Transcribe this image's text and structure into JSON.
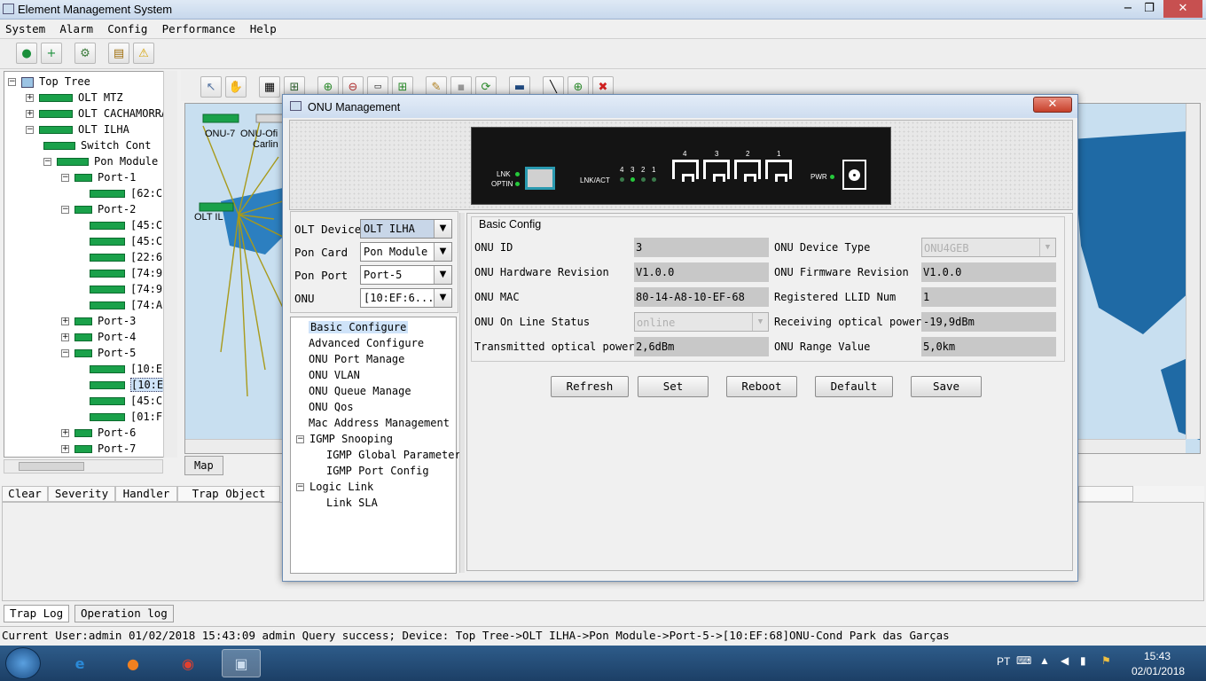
{
  "window": {
    "title": "Element Management System",
    "minimize": "−",
    "maximize": "❐",
    "close": "✕"
  },
  "menu": [
    "System",
    "Alarm",
    "Config",
    "Performance",
    "Help"
  ],
  "tree": {
    "items": [
      {
        "label": "Top Tree",
        "depth": 0,
        "exp": "−",
        "icon": "globe"
      },
      {
        "label": "OLT MTZ",
        "depth": 1,
        "exp": "+",
        "icon": "dev"
      },
      {
        "label": "OLT CACHAMORRA",
        "depth": 1,
        "exp": "+",
        "icon": "dev"
      },
      {
        "label": "OLT ILHA",
        "depth": 1,
        "exp": "−",
        "icon": "dev"
      },
      {
        "label": "Switch Cont",
        "depth": 2,
        "exp": "",
        "icon": "sw"
      },
      {
        "label": "Pon Module",
        "depth": 2,
        "exp": "−",
        "icon": "sw"
      },
      {
        "label": "Port-1",
        "depth": 3,
        "exp": "−",
        "icon": "port"
      },
      {
        "label": "[62:C",
        "depth": 4,
        "exp": "",
        "icon": "onu"
      },
      {
        "label": "Port-2",
        "depth": 3,
        "exp": "−",
        "icon": "port"
      },
      {
        "label": "[45:C",
        "depth": 4,
        "exp": "",
        "icon": "onu"
      },
      {
        "label": "[45:C",
        "depth": 4,
        "exp": "",
        "icon": "onu"
      },
      {
        "label": "[22:6",
        "depth": 4,
        "exp": "",
        "icon": "onu"
      },
      {
        "label": "[74:9",
        "depth": 4,
        "exp": "",
        "icon": "onu"
      },
      {
        "label": "[74:9",
        "depth": 4,
        "exp": "",
        "icon": "onu"
      },
      {
        "label": "[74:A",
        "depth": 4,
        "exp": "",
        "icon": "onu"
      },
      {
        "label": "Port-3",
        "depth": 3,
        "exp": "+",
        "icon": "port"
      },
      {
        "label": "Port-4",
        "depth": 3,
        "exp": "+",
        "icon": "port"
      },
      {
        "label": "Port-5",
        "depth": 3,
        "exp": "−",
        "icon": "port"
      },
      {
        "label": "[10:E",
        "depth": 4,
        "exp": "",
        "icon": "onu"
      },
      {
        "label": "[10:E",
        "depth": 4,
        "exp": "",
        "icon": "onu",
        "selected": true
      },
      {
        "label": "[45:C",
        "depth": 4,
        "exp": "",
        "icon": "onu"
      },
      {
        "label": "[01:F",
        "depth": 4,
        "exp": "",
        "icon": "onu"
      },
      {
        "label": "Port-6",
        "depth": 3,
        "exp": "+",
        "icon": "port"
      },
      {
        "label": "Port-7",
        "depth": 3,
        "exp": "+",
        "icon": "port"
      }
    ]
  },
  "map": {
    "labels": [
      "ONU-7",
      "ONU-Ofi",
      "Carlin",
      "OLT IL"
    ],
    "tab": "Map"
  },
  "traplog": {
    "columns": [
      "Clear",
      "Severity",
      "Handler",
      "Trap Object"
    ],
    "tabs": [
      "Trap Log",
      "Operation log"
    ]
  },
  "status": {
    "text": "Current User:admin   01/02/2018 15:43:09  admin  Query  success; Device: Top Tree->OLT ILHA->Pon Module->Port-5->[10:EF:68]ONU-Cond Park das Garças"
  },
  "taskbar": {
    "lang": "PT",
    "time": "15:43",
    "date": "02/01/2018",
    "apps": [
      "IE",
      "FF",
      "Chrome",
      "EMS"
    ]
  },
  "dialog": {
    "title": "ONU Management",
    "close": "✕",
    "device": {
      "lnk": "LNK",
      "optin": "OPTIN",
      "lnkact": "LNK/ACT",
      "ports_small": [
        "4",
        "3",
        "2",
        "1"
      ],
      "ports": [
        "4",
        "3",
        "2",
        "1"
      ],
      "pwr": "PWR"
    },
    "form": [
      {
        "label": "OLT Device",
        "value": "OLT ILHA"
      },
      {
        "label": "Pon Card",
        "value": "Pon Module"
      },
      {
        "label": "Pon Port",
        "value": "Port-5"
      },
      {
        "label": "ONU",
        "value": "[10:EF:6..."
      }
    ],
    "nav": [
      {
        "label": "Basic Configure",
        "indent": 0,
        "selected": true
      },
      {
        "label": "Advanced Configure",
        "indent": 0
      },
      {
        "label": "ONU Port Manage",
        "indent": 0
      },
      {
        "label": "ONU VLAN",
        "indent": 0
      },
      {
        "label": "ONU Queue Manage",
        "indent": 0
      },
      {
        "label": "ONU Qos",
        "indent": 0
      },
      {
        "label": "Mac Address Management",
        "indent": 0
      },
      {
        "label": "IGMP Snooping",
        "indent": 0,
        "exp": "−"
      },
      {
        "label": "IGMP Global Parameter",
        "indent": 1
      },
      {
        "label": "IGMP Port Config",
        "indent": 1
      },
      {
        "label": "Logic Link",
        "indent": 0,
        "exp": "−"
      },
      {
        "label": "Link SLA",
        "indent": 1
      }
    ],
    "config": {
      "title": "Basic Config",
      "left": [
        {
          "label": "ONU ID",
          "value": "3"
        },
        {
          "label": "ONU Hardware Revision",
          "value": "V1.0.0"
        },
        {
          "label": "ONU  MAC",
          "value": "80-14-A8-10-EF-68"
        },
        {
          "label": "ONU On Line Status",
          "value": "online",
          "combo": true
        },
        {
          "label": "Transmitted optical power",
          "value": "2,6dBm"
        }
      ],
      "right": [
        {
          "label": "ONU Device Type",
          "value": "ONU4GEB",
          "combo": true
        },
        {
          "label": "ONU Firmware Revision",
          "value": "V1.0.0"
        },
        {
          "label": "Registered LLID Num",
          "value": "1"
        },
        {
          "label": "Receiving optical power",
          "value": "-19,9dBm"
        },
        {
          "label": "ONU Range Value",
          "value": "5,0km"
        }
      ]
    },
    "buttons": [
      "Refresh",
      "Set",
      "Reboot",
      "Default",
      "Save"
    ]
  }
}
